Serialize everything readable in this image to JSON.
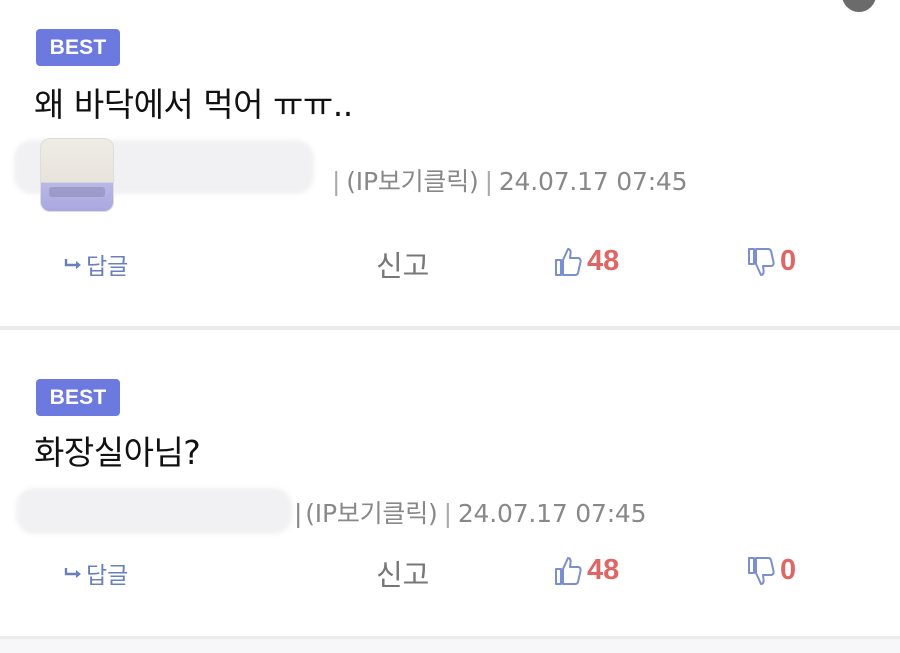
{
  "comments": [
    {
      "badge": "BEST",
      "text": "왜 바닥에서 먹어 ㅠㅠ..",
      "ip_label": "(IP보기클릭)",
      "timestamp": "24.07.17 07:45",
      "reply_label": "답글",
      "report_label": "신고",
      "likes": "48",
      "dislikes": "0"
    },
    {
      "badge": "BEST",
      "text": "화장실아님?",
      "ip_label": "(IP보기클릭)",
      "timestamp": "24.07.17 07:45",
      "reply_label": "답글",
      "report_label": "신고",
      "likes": "48",
      "dislikes": "0"
    }
  ],
  "separator": "|",
  "colors": {
    "badge": "#6c7ae0",
    "reply": "#6a80bd",
    "vote_count": "#e06666",
    "thumb_icon": "#7b8fd0",
    "meta_text": "#888888"
  },
  "icons": {
    "reply": "reply-arrow-icon",
    "like": "thumbs-up-icon",
    "dislike": "thumbs-down-icon"
  }
}
